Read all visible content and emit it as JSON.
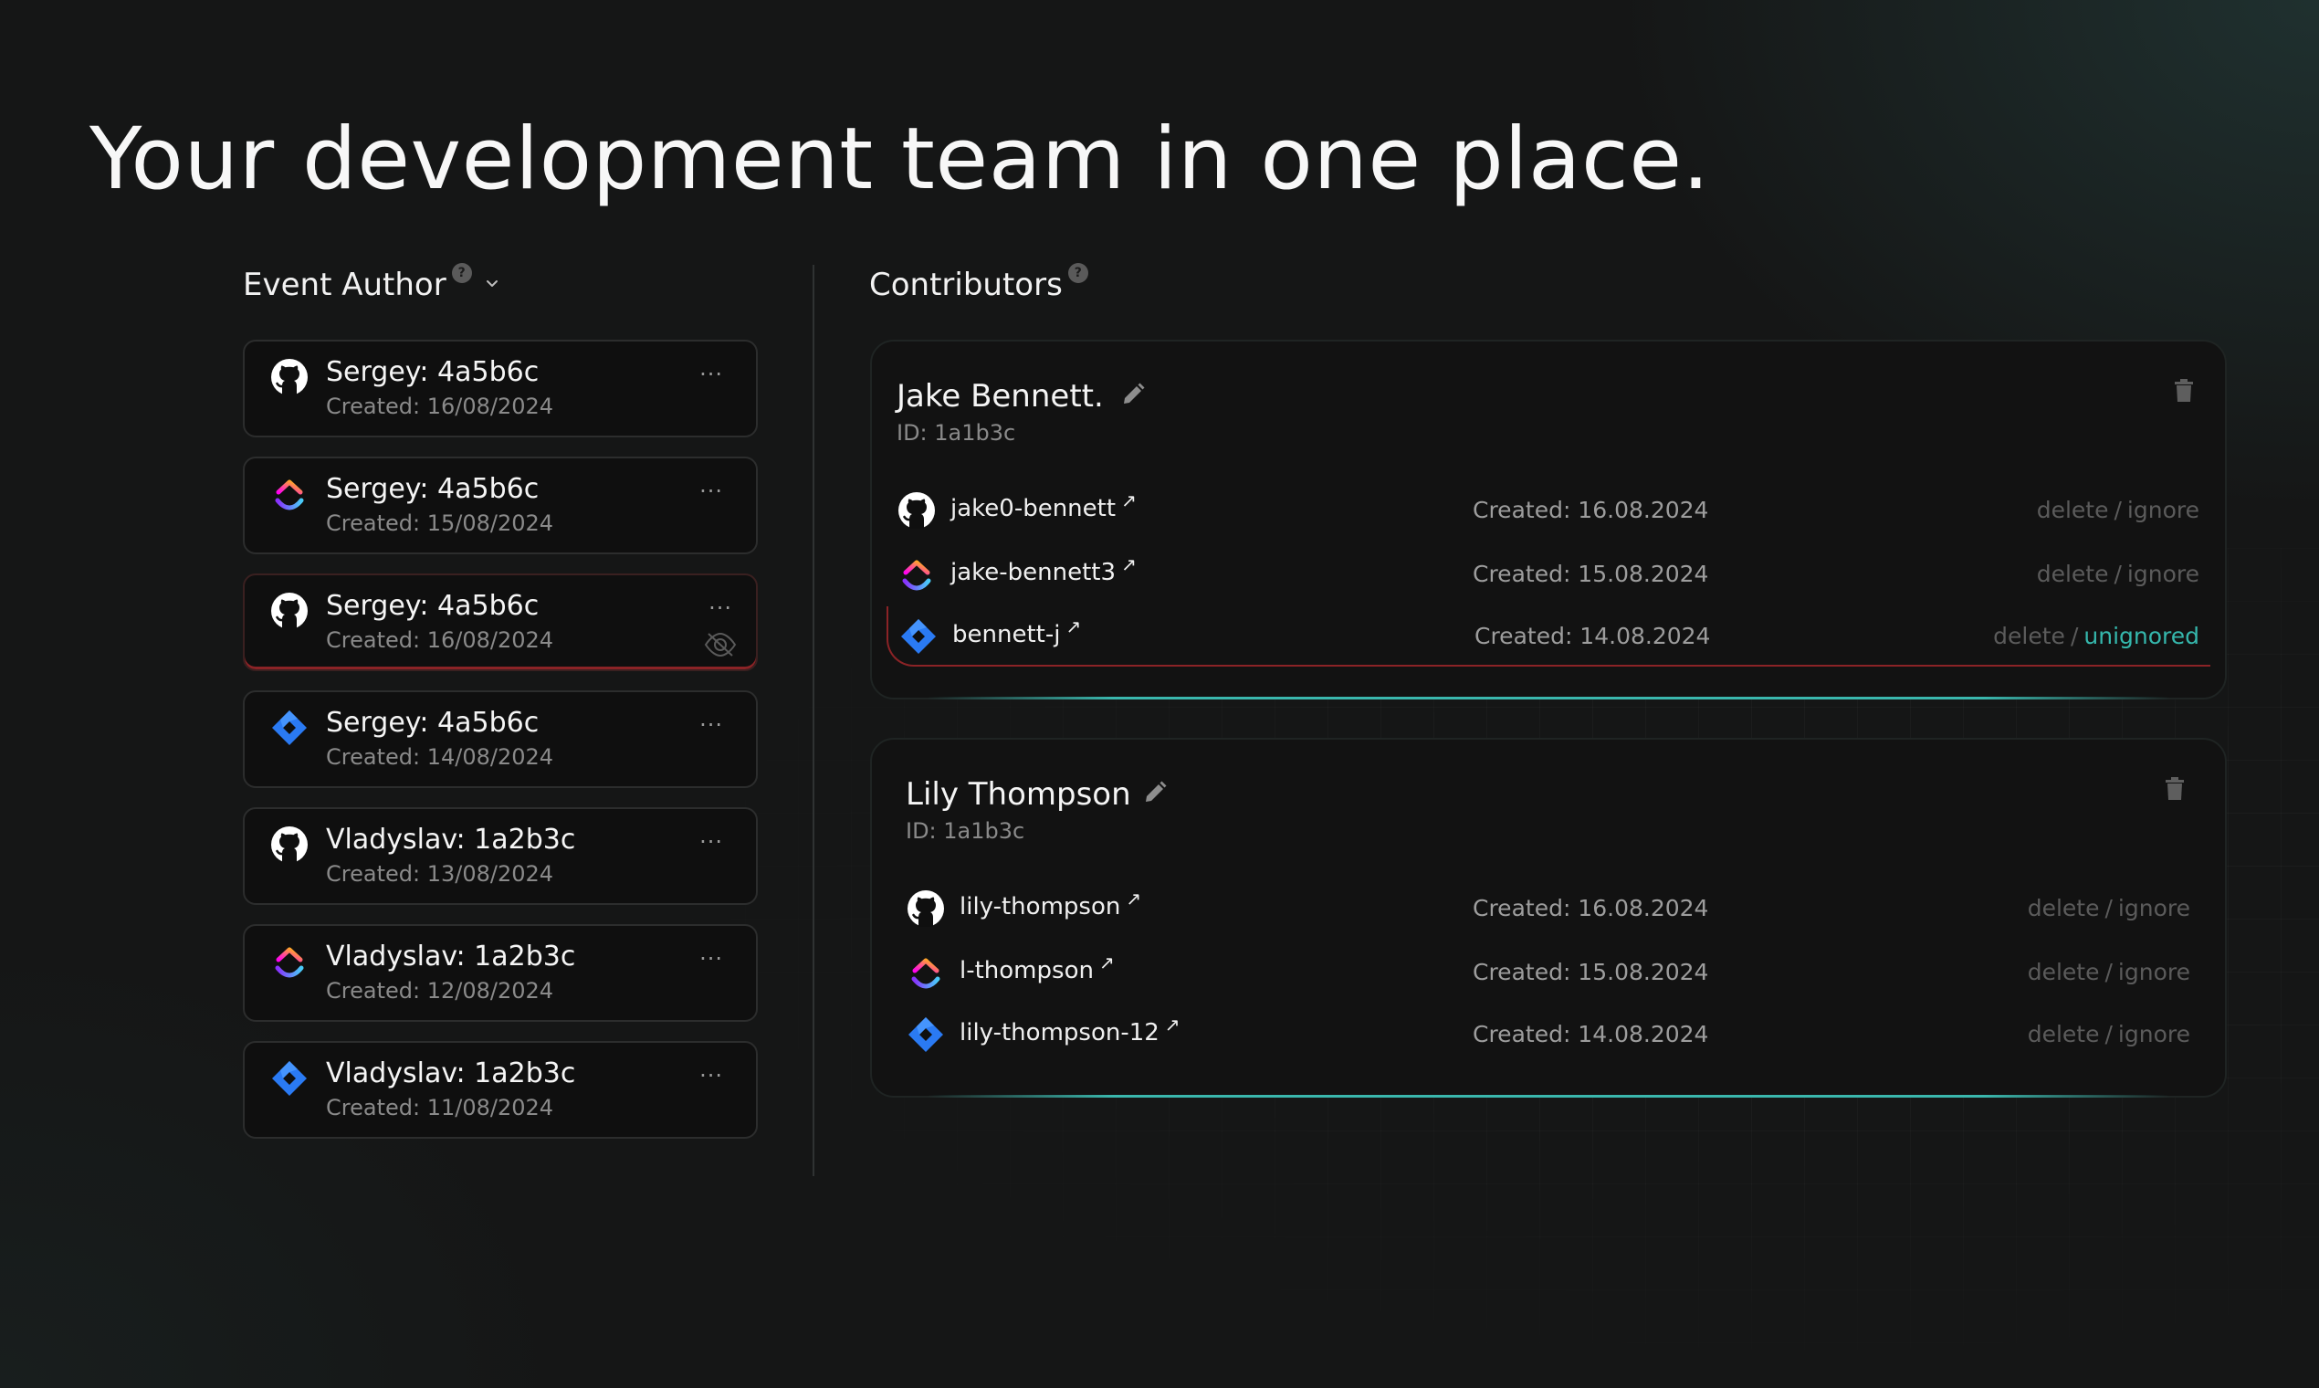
{
  "headline": "Your development team in one place.",
  "event_author": {
    "title": "Event Author",
    "help": "?",
    "items": [
      {
        "icon": "github-icon",
        "title": "Sergey: 4a5b6c",
        "created": "Created: 16/08/2024",
        "menu": "···",
        "flagged": false
      },
      {
        "icon": "clickup-icon",
        "title": "Sergey: 4a5b6c",
        "created": "Created: 15/08/2024",
        "menu": "···",
        "flagged": false
      },
      {
        "icon": "github-icon",
        "title": "Sergey: 4a5b6c",
        "created": "Created: 16/08/2024",
        "menu": "···",
        "flagged": true
      },
      {
        "icon": "jira-icon",
        "title": "Sergey: 4a5b6c",
        "created": "Created: 14/08/2024",
        "menu": "···",
        "flagged": false
      },
      {
        "icon": "github-icon",
        "title": "Vladyslav: 1a2b3c",
        "created": "Created: 13/08/2024",
        "menu": "···",
        "flagged": false
      },
      {
        "icon": "clickup-icon",
        "title": "Vladyslav: 1a2b3c",
        "created": "Created: 12/08/2024",
        "menu": "···",
        "flagged": false
      },
      {
        "icon": "jira-icon",
        "title": "Vladyslav: 1a2b3c",
        "created": "Created: 11/08/2024",
        "menu": "···",
        "flagged": false
      }
    ]
  },
  "contributors": {
    "title": "Contributors",
    "help": "?",
    "cards": [
      {
        "name": "Jake Bennett.",
        "id": "ID: 1a1b3c",
        "accounts": [
          {
            "icon": "github-icon",
            "username": "jake0-bennett",
            "created": "Created: 16.08.2024",
            "delete": "delete",
            "action": "ignore",
            "ignored": false
          },
          {
            "icon": "clickup-icon",
            "username": "jake-bennett3",
            "created": "Created: 15.08.2024",
            "delete": "delete",
            "action": "ignore",
            "ignored": false
          },
          {
            "icon": "jira-icon",
            "username": "bennett-j",
            "created": "Created: 14.08.2024",
            "delete": "delete",
            "action": "unignored",
            "ignored": true
          }
        ]
      },
      {
        "name": "Lily Thompson",
        "id": "ID: 1a1b3c",
        "accounts": [
          {
            "icon": "github-icon",
            "username": "lily-thompson",
            "created": "Created: 16.08.2024",
            "delete": "delete",
            "action": "ignore",
            "ignored": false
          },
          {
            "icon": "clickup-icon",
            "username": "l-thompson",
            "created": "Created: 15.08.2024",
            "delete": "delete",
            "action": "ignore",
            "ignored": false
          },
          {
            "icon": "jira-icon",
            "username": "lily-thompson-12",
            "created": "Created: 14.08.2024",
            "delete": "delete",
            "action": "ignore",
            "ignored": false
          }
        ]
      }
    ]
  },
  "colors": {
    "accent": "#35b7ac",
    "warning": "#8b2326",
    "background": "#151616",
    "card": "#0f0f0f"
  }
}
